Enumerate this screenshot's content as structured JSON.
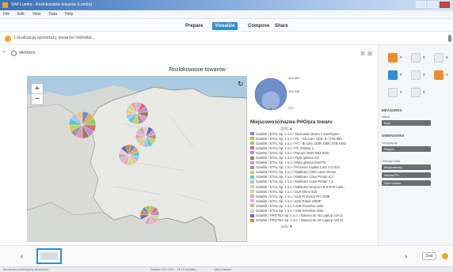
{
  "window": {
    "title": "SAP Lumira - Rozlokowanie towarów (Lumira)"
  },
  "menu": [
    "File",
    "Edit",
    "View",
    "Data",
    "Help"
  ],
  "nav": {
    "tabs": [
      "Prepare",
      "Visualize",
      "Compose",
      "Share"
    ],
    "active": "Visualize"
  },
  "header": {
    "title": "Lokalizacja sprzedaży towarów lodówka..."
  },
  "panel": {
    "label": "stichters"
  },
  "visualization": {
    "title": "Rozlokowanie towarów",
    "bubble_legend": [
      "309 864",
      "154 936",
      "237"
    ],
    "legend_title": "Miejscowość/nazwa PHO/pra towaru",
    "legend_page": "(2/2) ▲",
    "legend_more": "(4/2) ▼",
    "legend_items": [
      {
        "label": "Gdańsk / ETAL Sp. z o.o / Słuchawki stereo z interfejsem",
        "color": "#6a8fd3"
      },
      {
        "label": "Gdańsk / ETAL Sp. z o.o / PC - Gb core, SDD, 8 / 2TB 800",
        "color": "#f2a24a"
      },
      {
        "label": "Gdańsk / ETAL Sp. z o.o / PC - Bi core, DDR 1066, 2TB HDD",
        "color": "#8fcf6b"
      },
      {
        "label": "Gdańsk / ETAL Sp. z o.o / PC Zestaw 1",
        "color": "#e36b6b"
      },
      {
        "label": "Gdańsk / ETAL Sp. z o.o / Pamięć DDR 6/64 8GB",
        "color": "#b68fd6"
      },
      {
        "label": "Gdańsk / ETAL Sp. z o.o / Płyta główna ATI",
        "color": "#9c7a5c"
      },
      {
        "label": "Gdańsk / ETAL Sp. z o.o / Płyta główna Intel PV",
        "color": "#e98fc3"
      },
      {
        "label": "Gdańsk / ETAL Sp. z o.o / Procesor Inpaka Core 2.5 GHz",
        "color": "#9a9a9a"
      },
      {
        "label": "Gdańsk / ETAL Sp. z o.o / Rakliniec 1000 Laser Series",
        "color": "#cfd05a"
      },
      {
        "label": "Gdańsk / ETAL Sp. z o.o / Rakliniec Color Printer 6.3",
        "color": "#5fc7cf"
      },
      {
        "label": "Gdańsk / ETAL Sp. z o.o / Rakliniec Color Printer 7.9",
        "color": "#a9c4ec"
      },
      {
        "label": "Gdańsk / ETAL Sp. z o.o / Rakliniec Neuron Ink 8-Port Lase...",
        "color": "#f7c28a"
      },
      {
        "label": "Gdańsk / ETAL Sp. z o.o / SLR Mono 640",
        "color": "#b9e29a"
      },
      {
        "label": "Gdańsk / ETAL Sp. z o.o / SLR Procesor Pro 1038",
        "color": "#f2a3a3"
      },
      {
        "label": "Gdańsk / ETAL Sp. z o.o / Szaf Panel 1080P",
        "color": "#cbb6e6"
      },
      {
        "label": "Gdańsk / ETAL Sp. z o.o / USB Pendrive 1GB",
        "color": "#c8ad94"
      },
      {
        "label": "Gdańsk / ETAL Sp. z o.o / USB Pendrive 2GB",
        "color": "#f6c0dd"
      },
      {
        "label": "Gdańsk / PROTEA Sp. z o.o. / Bateria do 4G Laptop cell 11",
        "color": "#5576b8"
      },
      {
        "label": "Gdańsk / PROTEA Sp. z o.o. / Bateria do 4G Laptop cell 12",
        "color": "#e0862a"
      }
    ]
  },
  "right_panel": {
    "measures": {
      "heading": "MEASURES",
      "sub": "Value",
      "pill": "Ilość"
    },
    "dimensions": {
      "heading": "DIMENSIONS",
      "geo_label": "Geography",
      "geo_pill": "Region",
      "color_label": "Overlay Data",
      "pills": [
        "Miejscowość",
        "Nazwa PH",
        "Opis towaru"
      ]
    }
  },
  "filmstrip": {
    "done_label": "Dod"
  },
  "statusbar": [
    "Akcelerator przekrojowy akcelerator...",
    "Dataset: 26.1.2017 - 14:13 Wymiary",
    "Value Dataset"
  ]
}
